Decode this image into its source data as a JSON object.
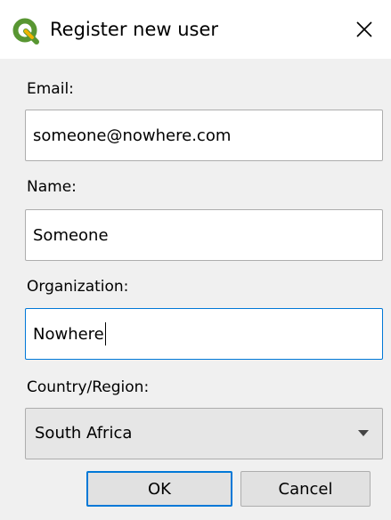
{
  "window": {
    "title": "Register new user",
    "icon": "qgis-logo-icon",
    "close_icon": "close-icon"
  },
  "form": {
    "email_label": "Email:",
    "email_value": "someone@nowhere.com",
    "name_label": "Name:",
    "name_value": "Someone",
    "organization_label": "Organization:",
    "organization_value": "Nowhere",
    "country_label": "Country/Region:",
    "country_value": "South Africa"
  },
  "buttons": {
    "ok_label": "OK",
    "cancel_label": "Cancel"
  },
  "colors": {
    "accent": "#0078d7",
    "logo_green": "#589632",
    "logo_yellow": "#f0b400"
  }
}
